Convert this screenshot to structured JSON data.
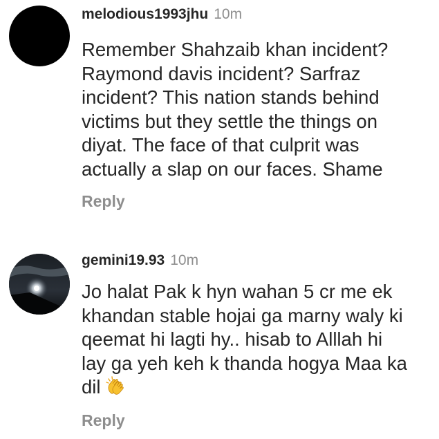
{
  "comments": [
    {
      "username": "melodious1993jhu",
      "timestamp": "10m",
      "text": "Remember Shahzaib khan incident?\nRaymond davis incident? Sarfraz\nincident? This nation stands behind\nvictims but they settle the things on\ndiyat. The face of that culprit was\nactually a slap on our faces. Shame",
      "reply_label": "Reply",
      "avatar_icon": "black-circle-avatar"
    },
    {
      "username": "gemini19.93",
      "timestamp": "10m",
      "text": "Jo halat Pak k hyn wahan 5 cr me ek\nkhandan stable hojai ga marny waly ki\nqeemat hi lagti hy.. hisab to Alllah hi\nlay ga yeh keh k thanda hogya Maa ka\ndil",
      "emoji": "clapping-hands-icon",
      "reply_label": "Reply",
      "avatar_icon": "night-sky-moon-avatar"
    }
  ],
  "colors": {
    "text": "#262626",
    "muted": "#8e8e8e",
    "background": "#ffffff"
  }
}
